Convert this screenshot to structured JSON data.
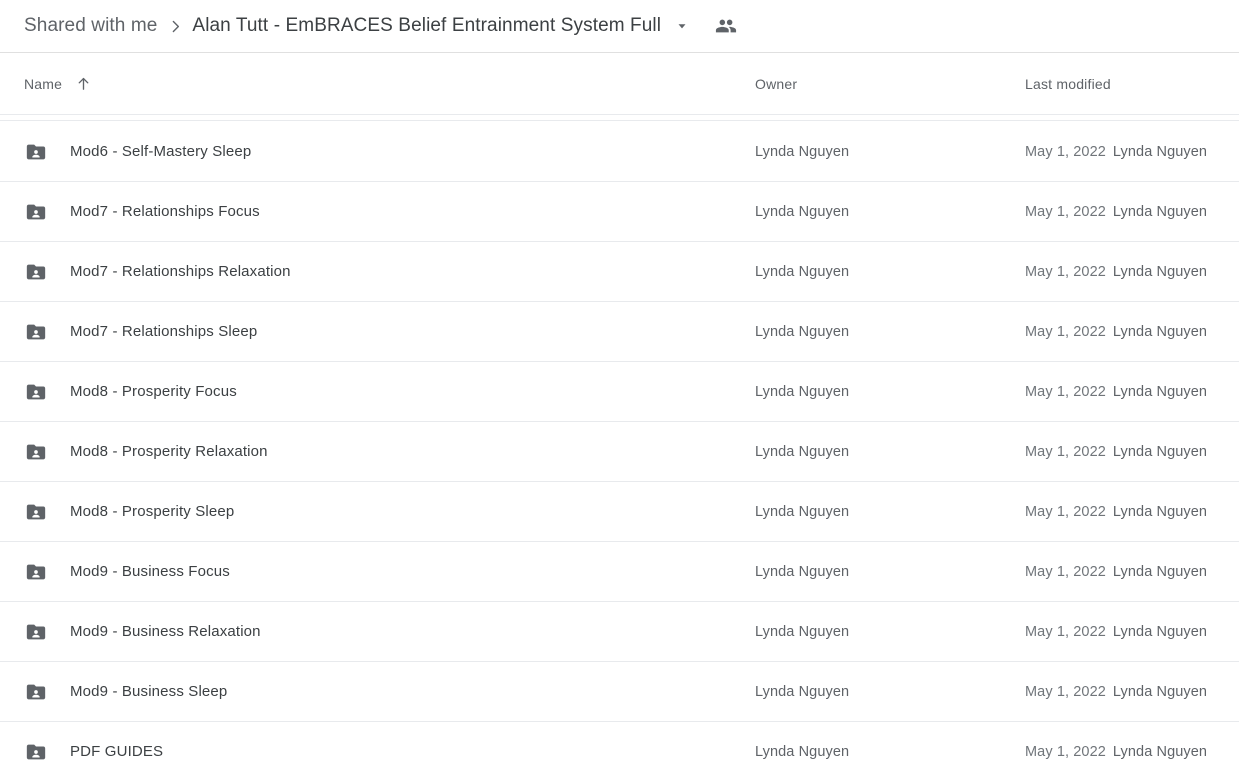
{
  "breadcrumb": {
    "parent_label": "Shared with me",
    "separator_icon": "chevron-right-icon",
    "current_label": "Alan Tutt - EmBRACES Belief Entrainment System Full",
    "caret_icon": "chevron-down-icon",
    "people_icon": "people-icon"
  },
  "columns": {
    "name": "Name",
    "sort_icon": "arrow-up-icon",
    "owner": "Owner",
    "last_modified": "Last modified"
  },
  "colors": {
    "folder_icon": "#5f6368",
    "text_primary": "#3c4043",
    "text_secondary": "#5f6368",
    "divider": "#e8eaed",
    "background": "#ffffff"
  },
  "files": [
    {
      "icon": "shared-folder-icon",
      "name": "Mod6 - Self-Mastery Sleep",
      "owner": "Lynda Nguyen",
      "modified_date": "May 1, 2022",
      "modified_by": "Lynda Nguyen"
    },
    {
      "icon": "shared-folder-icon",
      "name": "Mod7 - Relationships Focus",
      "owner": "Lynda Nguyen",
      "modified_date": "May 1, 2022",
      "modified_by": "Lynda Nguyen"
    },
    {
      "icon": "shared-folder-icon",
      "name": "Mod7 - Relationships Relaxation",
      "owner": "Lynda Nguyen",
      "modified_date": "May 1, 2022",
      "modified_by": "Lynda Nguyen"
    },
    {
      "icon": "shared-folder-icon",
      "name": "Mod7 - Relationships Sleep",
      "owner": "Lynda Nguyen",
      "modified_date": "May 1, 2022",
      "modified_by": "Lynda Nguyen"
    },
    {
      "icon": "shared-folder-icon",
      "name": "Mod8 - Prosperity Focus",
      "owner": "Lynda Nguyen",
      "modified_date": "May 1, 2022",
      "modified_by": "Lynda Nguyen"
    },
    {
      "icon": "shared-folder-icon",
      "name": "Mod8 - Prosperity Relaxation",
      "owner": "Lynda Nguyen",
      "modified_date": "May 1, 2022",
      "modified_by": "Lynda Nguyen"
    },
    {
      "icon": "shared-folder-icon",
      "name": "Mod8 - Prosperity Sleep",
      "owner": "Lynda Nguyen",
      "modified_date": "May 1, 2022",
      "modified_by": "Lynda Nguyen"
    },
    {
      "icon": "shared-folder-icon",
      "name": "Mod9 - Business Focus",
      "owner": "Lynda Nguyen",
      "modified_date": "May 1, 2022",
      "modified_by": "Lynda Nguyen"
    },
    {
      "icon": "shared-folder-icon",
      "name": "Mod9 - Business Relaxation",
      "owner": "Lynda Nguyen",
      "modified_date": "May 1, 2022",
      "modified_by": "Lynda Nguyen"
    },
    {
      "icon": "shared-folder-icon",
      "name": "Mod9 - Business Sleep",
      "owner": "Lynda Nguyen",
      "modified_date": "May 1, 2022",
      "modified_by": "Lynda Nguyen"
    },
    {
      "icon": "shared-folder-icon",
      "name": "PDF GUIDES",
      "owner": "Lynda Nguyen",
      "modified_date": "May 1, 2022",
      "modified_by": "Lynda Nguyen"
    }
  ]
}
